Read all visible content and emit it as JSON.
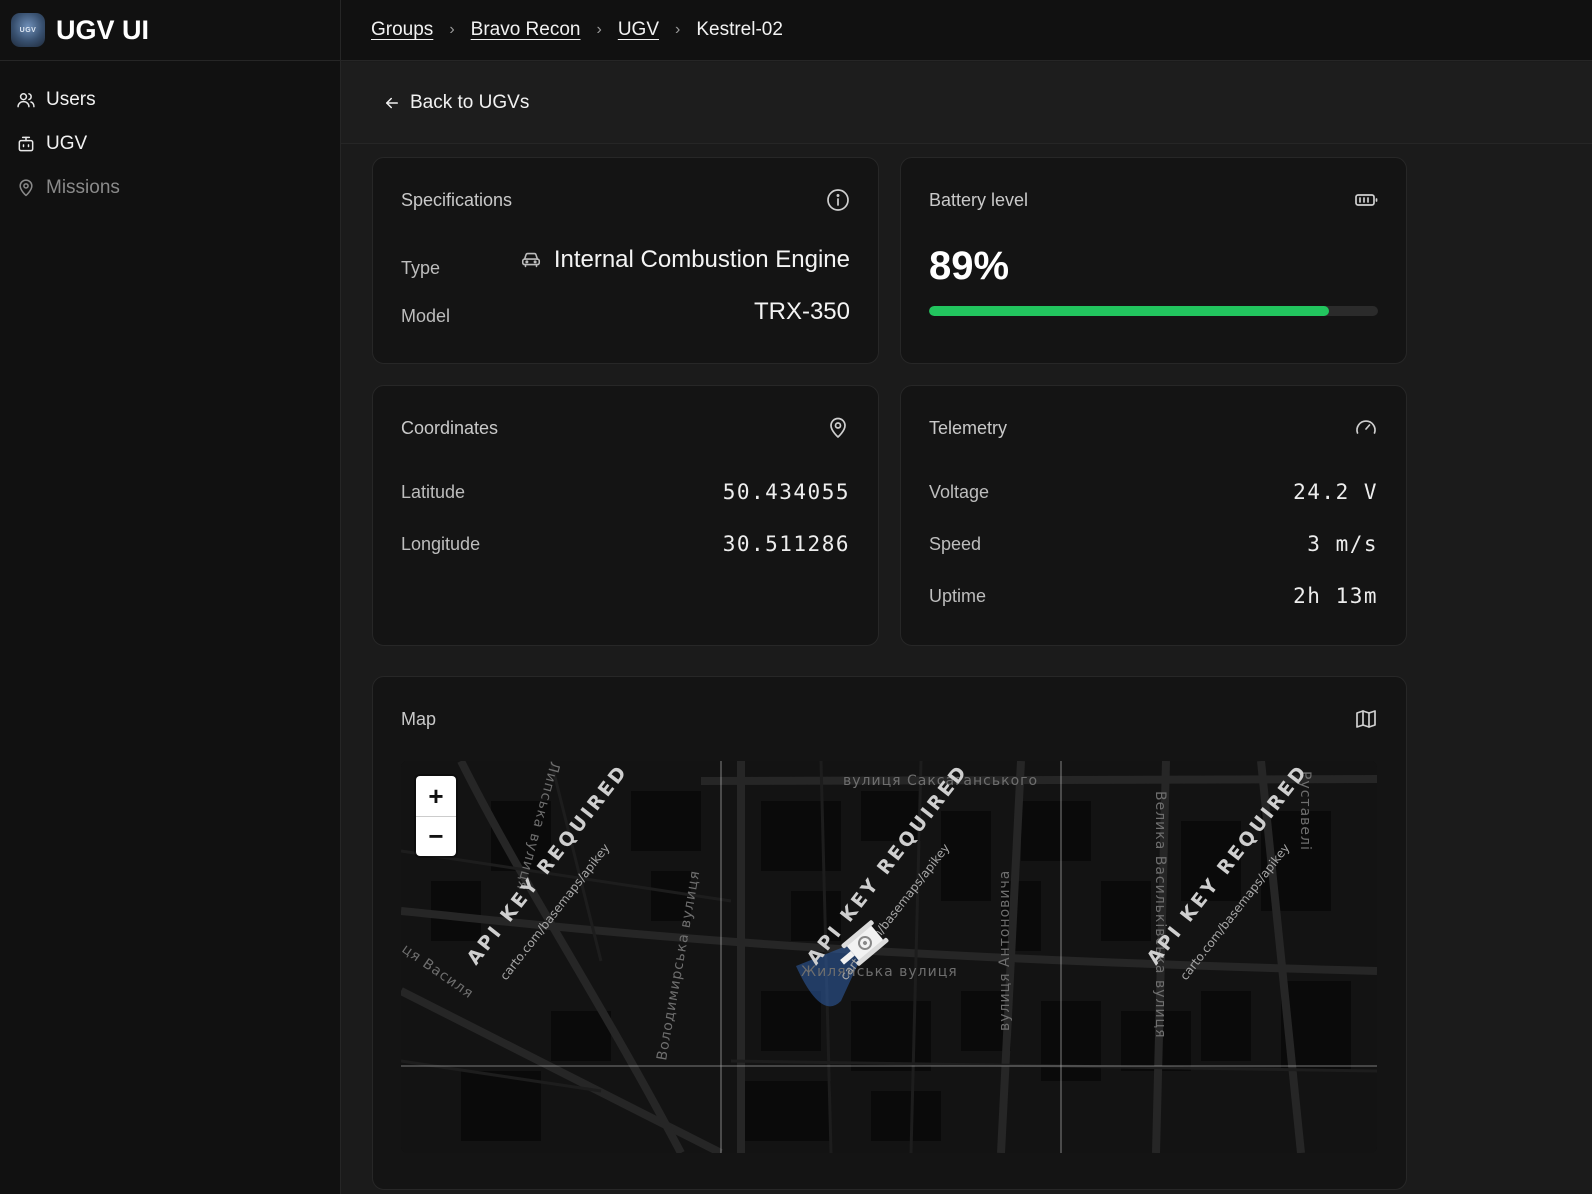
{
  "app": {
    "title": "UGV UI",
    "logo_text": "UGV"
  },
  "sidebar": {
    "items": [
      {
        "label": "Users",
        "icon": "users-icon"
      },
      {
        "label": "UGV",
        "icon": "robot-icon"
      },
      {
        "label": "Missions",
        "icon": "map-pin-icon"
      }
    ]
  },
  "breadcrumb": {
    "items": [
      "Groups",
      "Bravo Recon",
      "UGV"
    ],
    "current": "Kestrel-02",
    "separator": "›"
  },
  "back": {
    "label": "Back to UGVs"
  },
  "specifications": {
    "title": "Specifications",
    "icon": "info-icon",
    "type_label": "Type",
    "type_value": "Internal Combustion Engine",
    "type_icon": "car-icon",
    "model_label": "Model",
    "model_value": "TRX-350"
  },
  "battery": {
    "title": "Battery level",
    "icon": "battery-icon",
    "percent_text": "89%",
    "level": 0.89,
    "color": "#22c55e"
  },
  "coordinates": {
    "title": "Coordinates",
    "icon": "map-pin-icon",
    "latitude_label": "Latitude",
    "latitude": "50.434055",
    "longitude_label": "Longitude",
    "longitude": "30.511286"
  },
  "telemetry": {
    "title": "Telemetry",
    "icon": "gauge-icon",
    "voltage_label": "Voltage",
    "voltage": "24.2 V",
    "speed_label": "Speed",
    "speed": "3 m/s",
    "uptime_label": "Uptime",
    "uptime": "2h 13m"
  },
  "map": {
    "title": "Map",
    "icon": "map-icon",
    "zoom_in": "+",
    "zoom_out": "−",
    "watermark": "API KEY REQUIRED",
    "watermark_url": "carto.com/basemaps/apikey",
    "streets": [
      "вулиця Саксаганського",
      "Жилянська вулиця",
      "вулиця Антоновича",
      "Велика Васильківська вулиця",
      "Володимирська вулиця",
      "Руставелі",
      "Липська вулиця",
      "ця Василя"
    ],
    "marker_icon": "ugv-marker-icon"
  }
}
